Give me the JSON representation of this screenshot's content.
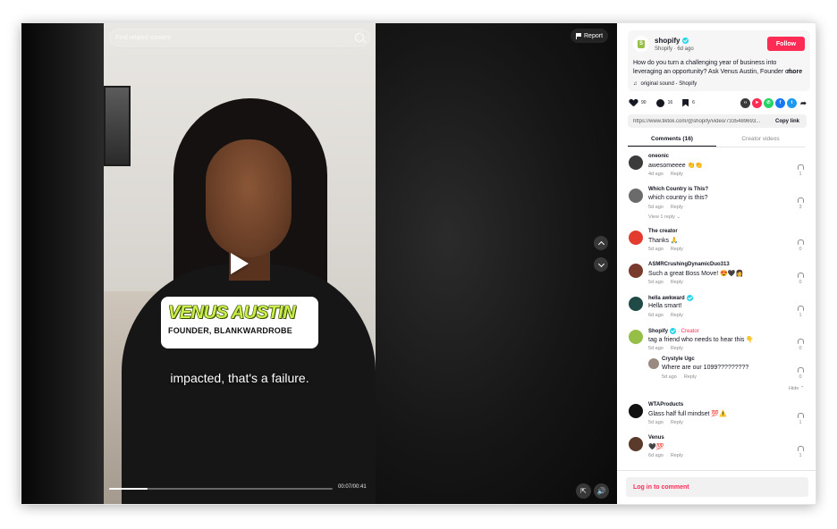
{
  "video": {
    "search_placeholder": "Find related content",
    "report_label": "Report",
    "overlay_name": "VENUS AUSTIN",
    "overlay_role": "FOUNDER, BLANKWARDROBE",
    "caption": "impacted, that's a failure.",
    "time": "00:07/00:41",
    "progress_fraction": 0.17
  },
  "post": {
    "author": "shopify",
    "author_sub": "Shopify · 6d ago",
    "follow_label": "Follow",
    "description": "How do you turn a challenging year of business into leveraging an opportunity? Ask Venus Austin, Founder of...",
    "more_label": "more",
    "sound": "original sound - Shopify",
    "likes": "90",
    "comments_count": "16",
    "saves": "6",
    "url": "https://www.tiktok.com/@shopify/video/7335489693...",
    "copy_label": "Copy link",
    "share_colors": [
      "#3a3a3a",
      "#fe2c55",
      "#25d366",
      "#1877f2",
      "#1d9bf0"
    ]
  },
  "tabs": [
    {
      "label": "Comments (16)"
    },
    {
      "label": "Creator videos"
    }
  ],
  "comments": [
    {
      "user": "oneonic",
      "text": "awesomeeee 👏👏",
      "age": "4d ago",
      "reply": "Reply",
      "likes": "1",
      "color": "#3b3b3b"
    },
    {
      "user": "Which Country is This?",
      "text": "which country is this?",
      "age": "5d ago",
      "reply": "Reply",
      "likes": "3",
      "color": "#6b6b6b",
      "sub": "View 1 reply ⌄"
    },
    {
      "user": "The creator",
      "text": "Thanks 🙏",
      "age": "5d ago",
      "reply": "Reply",
      "likes": "0",
      "color": "#e33c2f"
    },
    {
      "user": "ASMRCrushingDynamicDuo313",
      "text": "Such a great Boss Move! 😍🖤👩",
      "age": "5d ago",
      "reply": "Reply",
      "likes": "0",
      "color": "#7a3b2f"
    },
    {
      "user": "hella awkward",
      "text": "Hella smart!",
      "age": "6d ago",
      "reply": "Reply",
      "likes": "1",
      "color": "#1f4a46"
    },
    {
      "user": "Shopify",
      "creator_tag": "· Creator",
      "text": "tag a friend who needs to hear this 👇",
      "age": "5d ago",
      "reply": "Reply",
      "likes": "0",
      "color": "#95bf47"
    },
    {
      "user": "Crystyle Ugc",
      "text": "Where are our 1099?????????",
      "age": "5d ago",
      "reply": "Reply",
      "likes": "0",
      "color": "#9b8a80",
      "hide": "Hide ⌃"
    },
    {
      "user": "WTAProducts",
      "text": "Glass half full mindset 💯⚠️",
      "age": "5d ago",
      "reply": "Reply",
      "likes": "1",
      "color": "#111111"
    },
    {
      "user": "Venus",
      "text": "🖤💯",
      "age": "6d ago",
      "reply": "Reply",
      "likes": "1",
      "color": "#5a3a2a"
    }
  ],
  "login_label": "Log in to comment"
}
